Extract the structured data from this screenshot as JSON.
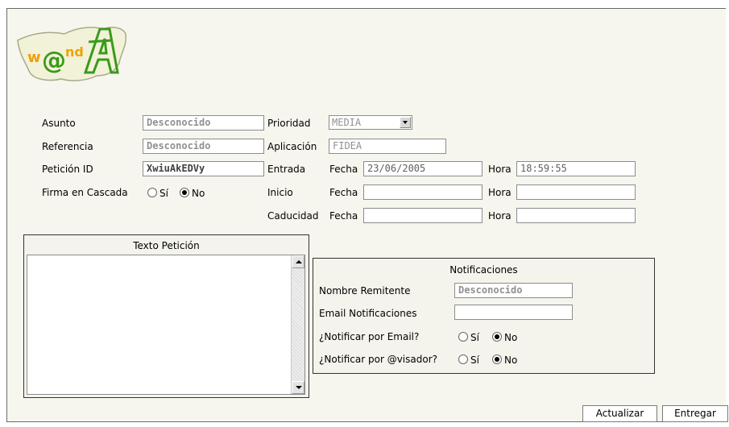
{
  "form": {
    "asunto_label": "Asunto",
    "asunto_value": "Desconocido",
    "prioridad_label": "Prioridad",
    "prioridad_value": "MEDIA",
    "referencia_label": "Referencia",
    "referencia_value": "Desconocido",
    "aplicacion_label": "Aplicación",
    "aplicacion_value": "FIDEA",
    "peticion_label": "Petición ID",
    "peticion_value": "XwiuAkEDVy",
    "entrada_label": "Entrada",
    "entrada_fecha_label": "Fecha",
    "entrada_fecha_value": "23/06/2005",
    "entrada_hora_label": "Hora",
    "entrada_hora_value": "18:59:55",
    "firma_label": "Firma en Cascada",
    "firma_si": "Sí",
    "firma_no": "No",
    "inicio_label": "Inicio",
    "inicio_fecha_label": "Fecha",
    "inicio_hora_label": "Hora",
    "caducidad_label": "Caducidad",
    "caducidad_fecha_label": "Fecha",
    "caducidad_hora_label": "Hora"
  },
  "texto": {
    "title": "Texto Petición"
  },
  "notificaciones": {
    "title": "Notificaciones",
    "remitente_label": "Nombre Remitente",
    "remitente_value": "Desconocido",
    "email_label": "Email Notificaciones",
    "notificar_email_label": "¿Notificar por Email?",
    "notificar_visador_label": "¿Notificar por @visador?",
    "si": "Sí",
    "no": "No"
  },
  "buttons": {
    "actualizar": "Actualizar",
    "entregar": "Entregar"
  },
  "colors": {
    "background": "#f6f6ee",
    "logo_green": "#3a9a1a",
    "logo_orange": "#f0a000"
  },
  "icons": {
    "logo": "wanda-logo",
    "scroll_up": "scroll-up-arrow",
    "scroll_down": "scroll-down-arrow"
  }
}
